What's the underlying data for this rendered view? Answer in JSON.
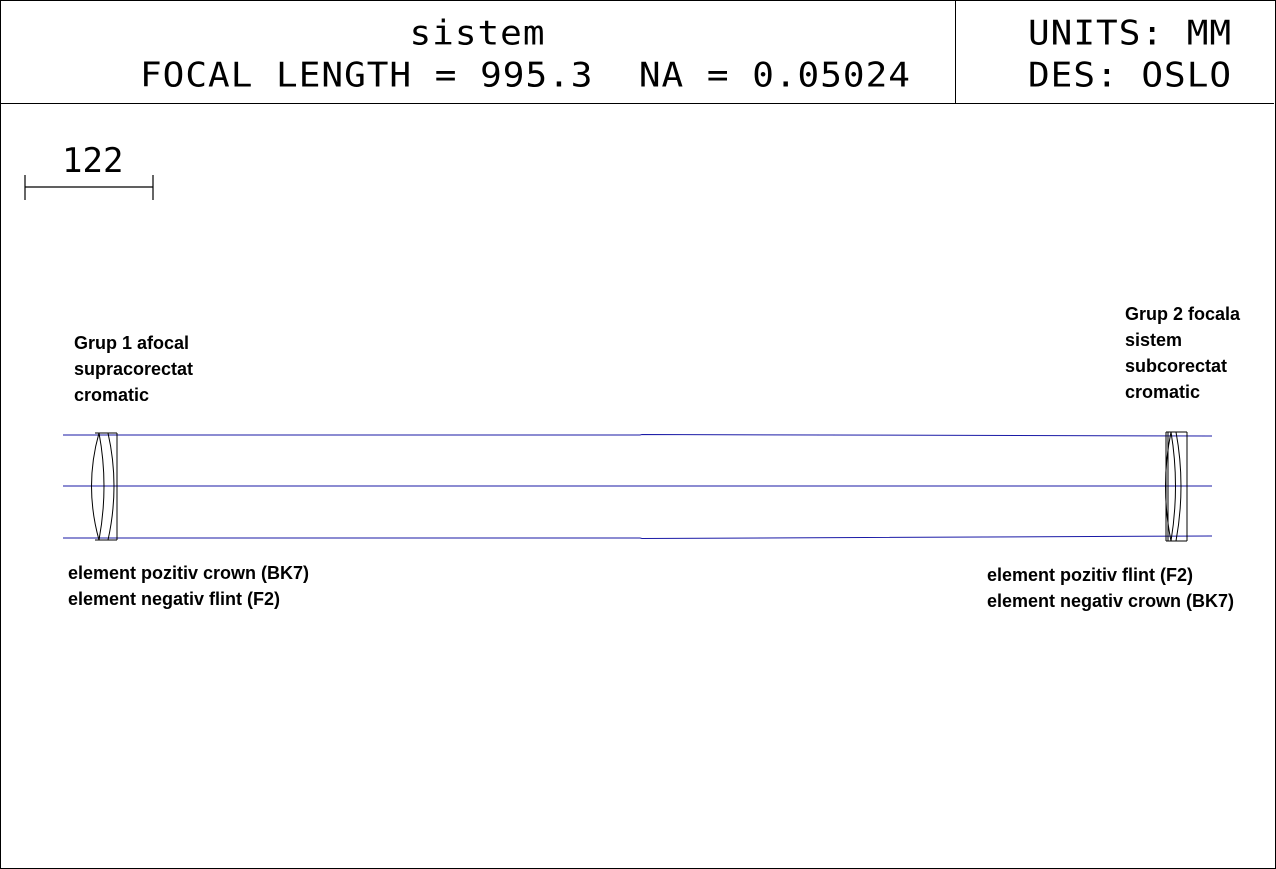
{
  "header": {
    "system_name": "sistem",
    "focal_line": "FOCAL LENGTH = 995.3  NA = 0.05024",
    "units_line": "UNITS: MM",
    "designer_line": "DES: OSLO"
  },
  "scale_bar": {
    "value": "122"
  },
  "annotations": {
    "group1": {
      "lines": [
        "Grup 1 afocal",
        "supracorectat",
        "cromatic"
      ]
    },
    "group1_elements": {
      "lines": [
        "element pozitiv crown (BK7)",
        "element negativ flint (F2)"
      ]
    },
    "group2": {
      "lines": [
        "Grup 2 focala",
        "sistem",
        "subcorectat",
        "cromatic"
      ]
    },
    "group2_elements": {
      "lines": [
        "element pozitiv flint (F2)",
        "element negativ crown (BK7)"
      ]
    }
  },
  "colors": {
    "ray": "#1a1aa6",
    "outline": "#000000",
    "background": "#ffffff"
  }
}
